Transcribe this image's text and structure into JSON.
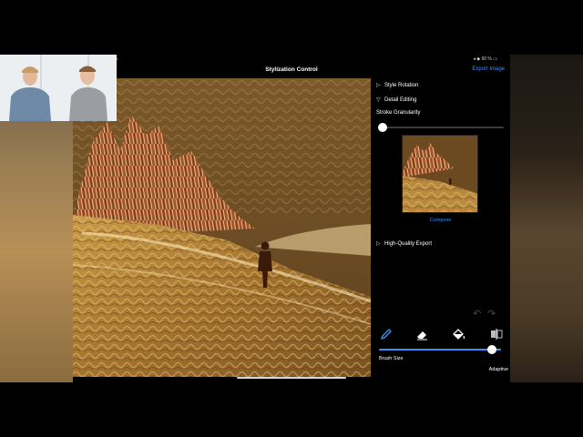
{
  "statusbar": {
    "time": "n.",
    "status": "◂ ◆ 90 % ▭"
  },
  "navbar": {
    "title": "Stylization Control",
    "export_label": "Export Image"
  },
  "panel": {
    "style_rotation": "Style Rotation",
    "detail_editing": "Detail Editing",
    "stroke_granularity": "Stroke Granularity",
    "stroke_granularity_value": 0,
    "compose_label": "Compose",
    "hq_export": "High-Quality Export",
    "brush_size_label": "Brush Size",
    "brush_size_value": 0.96,
    "adaptive_label": "Adaptive"
  },
  "icons": {
    "collapsed": "▷",
    "expanded": "▽",
    "undo": "↶",
    "redo": "↷"
  },
  "colors": {
    "accent": "#3b8ff7",
    "background": "#000000",
    "text": "#ffffff"
  }
}
